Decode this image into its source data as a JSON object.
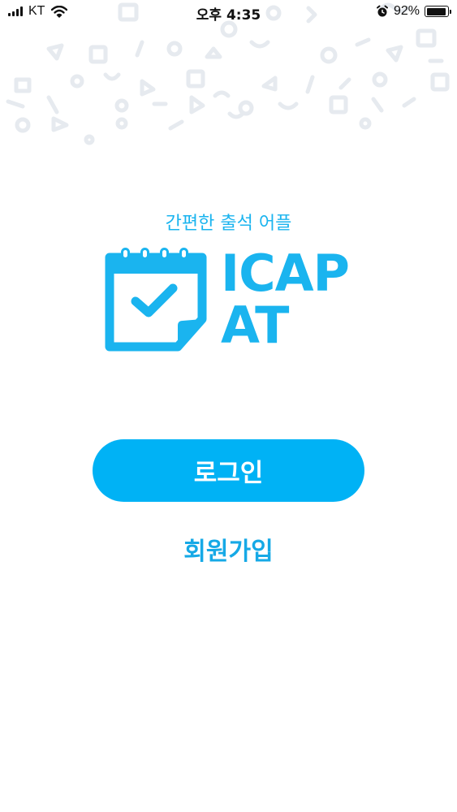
{
  "status_bar": {
    "carrier": "KT",
    "time": "오후 4:35",
    "battery_percent": "92%",
    "battery_level": 0.92,
    "icons": [
      "signal-icon",
      "wifi-icon",
      "alarm-icon",
      "battery-icon"
    ]
  },
  "app": {
    "tagline": "간편한 출석 어플",
    "logo_line1": "ICAP",
    "logo_line2": "AT",
    "logo_icon": "calendar-check-icon"
  },
  "actions": {
    "login_label": "로그인",
    "signup_label": "회원가입"
  },
  "colors": {
    "brand": "#1ab4ef",
    "button": "#00b2f5",
    "pattern": "#eaeef2",
    "background": "#ffffff"
  }
}
